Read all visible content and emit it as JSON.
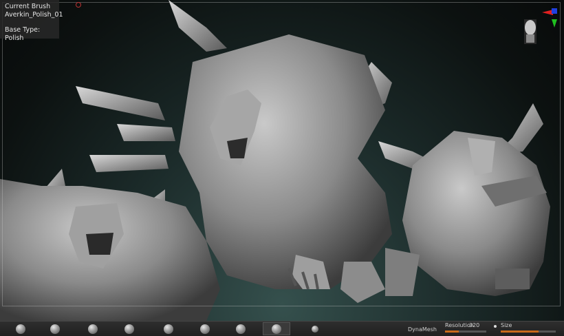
{
  "info_panel": {
    "title": "Current Brush",
    "brush_name": "Averkin_Polish_01",
    "base_type": "Base Type: Polish"
  },
  "canvas": {
    "description_icon": "sculpt-render",
    "background_top": "#080a0a",
    "background_bottom": "#35504d"
  },
  "gizmo": {
    "icon": "head-orientation-icon",
    "x_axis_color": "#e02020",
    "y_axis_color": "#20c020",
    "z_axis_color": "#2040e0"
  },
  "toolbar": {
    "brushes": [
      "brush-1",
      "brush-2",
      "brush-3",
      "brush-4",
      "brush-5",
      "brush-6",
      "brush-7",
      "brush-8",
      "brush-9"
    ],
    "dynamesh_label": "DynaMesh",
    "resolution_label": "Resolution",
    "resolution_value": "320",
    "size_label": "Size",
    "accent_color": "#c86a1a"
  }
}
